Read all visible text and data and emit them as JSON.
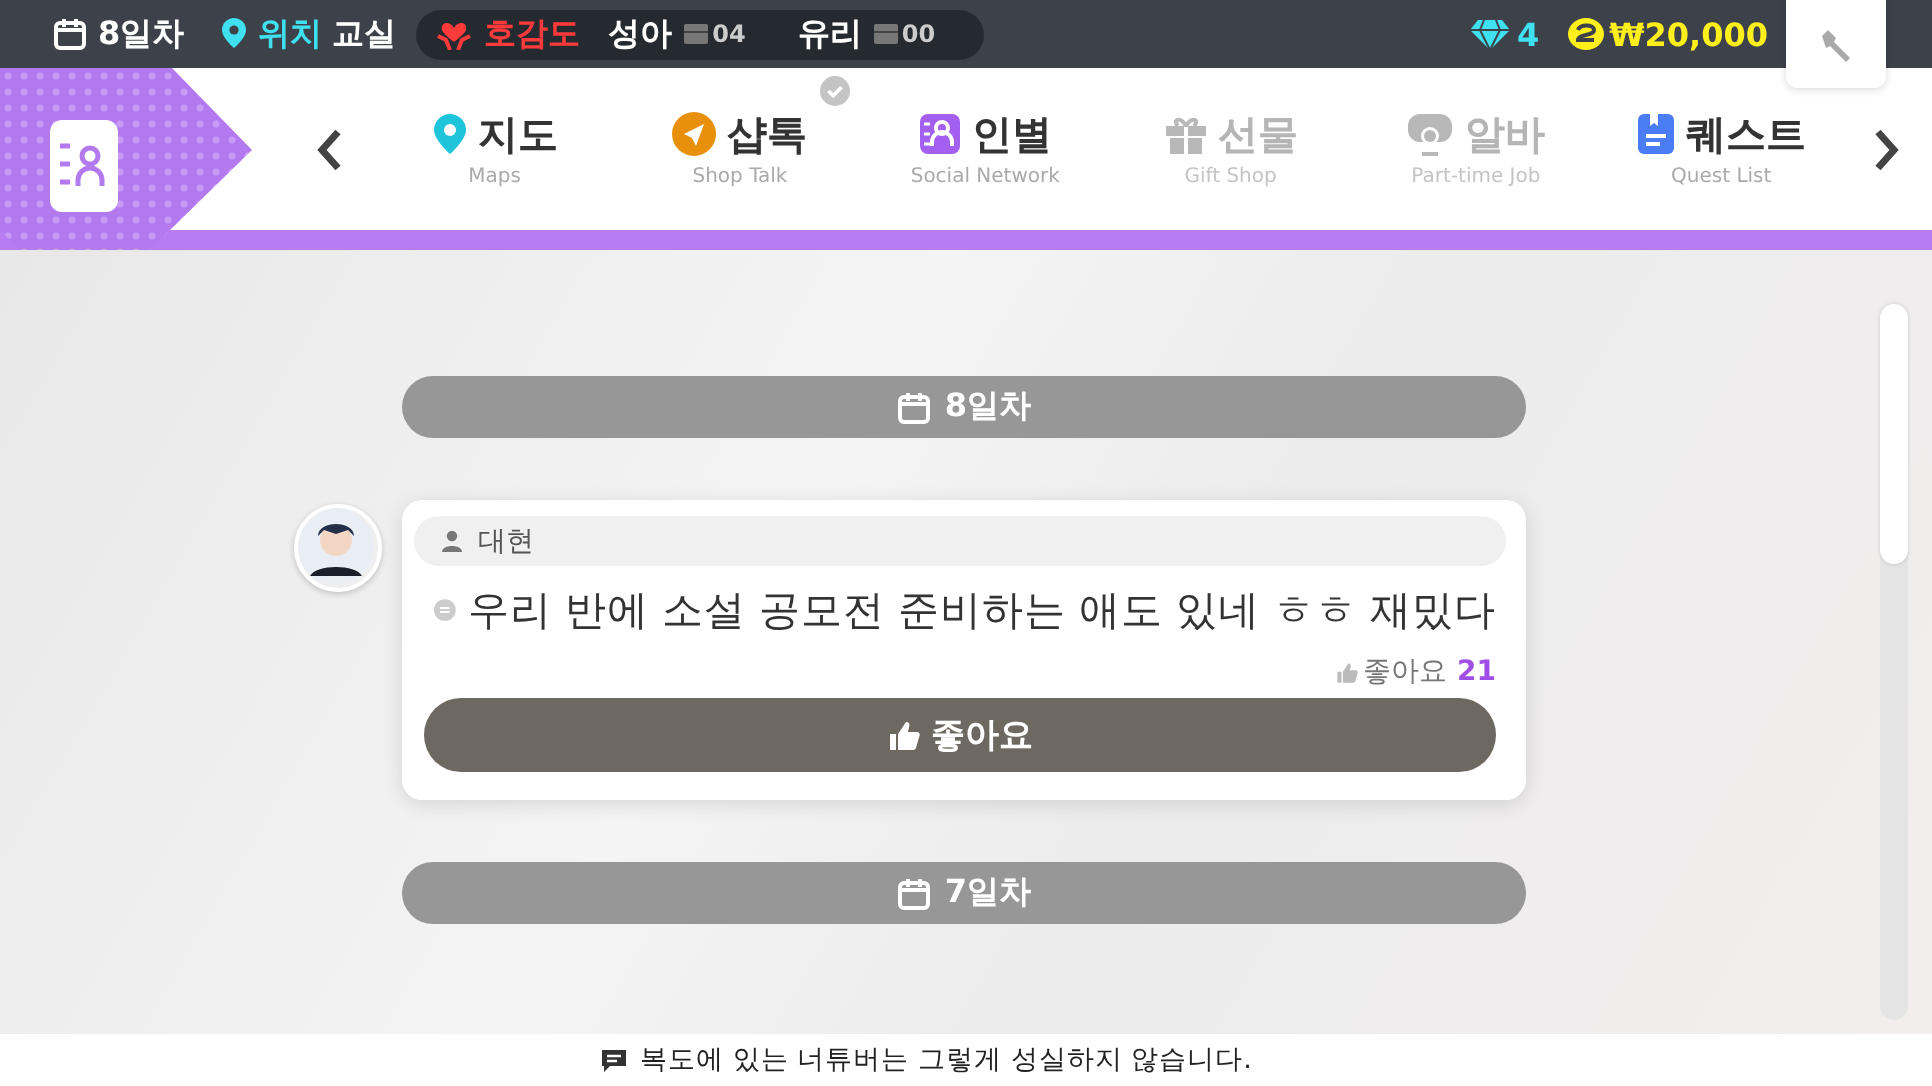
{
  "status_bar": {
    "day": "8일차",
    "location_label": "위치",
    "location": "교실",
    "affection_label": "호감도",
    "affections": [
      {
        "name": "성아",
        "value": "04"
      },
      {
        "name": "유리",
        "value": "00"
      }
    ],
    "gems": "4",
    "money": "₩20,000"
  },
  "nav": {
    "tabs": [
      {
        "label": "지도",
        "sublabel": "Maps",
        "disabled": false,
        "checked": false
      },
      {
        "label": "샵톡",
        "sublabel": "Shop Talk",
        "disabled": false,
        "checked": true
      },
      {
        "label": "인별",
        "sublabel": "Social Network",
        "disabled": false,
        "checked": false
      },
      {
        "label": "선물",
        "sublabel": "Gift Shop",
        "disabled": true,
        "checked": false
      },
      {
        "label": "알바",
        "sublabel": "Part-time Job",
        "disabled": true,
        "checked": false
      },
      {
        "label": "퀘스트",
        "sublabel": "Quest List",
        "disabled": false,
        "checked": false
      }
    ]
  },
  "feed": [
    {
      "kind": "day",
      "label": "8일차"
    },
    {
      "kind": "post",
      "author": "대현",
      "text": "우리 반에 소설 공모전 준비하는 애도 있네 ㅎㅎ 재밌다",
      "likes_label": "좋아요",
      "likes": "21",
      "button": "좋아요"
    },
    {
      "kind": "day",
      "label": "7일차"
    }
  ],
  "ticker": "복도에 있는 너튜버는 그렇게 성실하지 않습니다."
}
